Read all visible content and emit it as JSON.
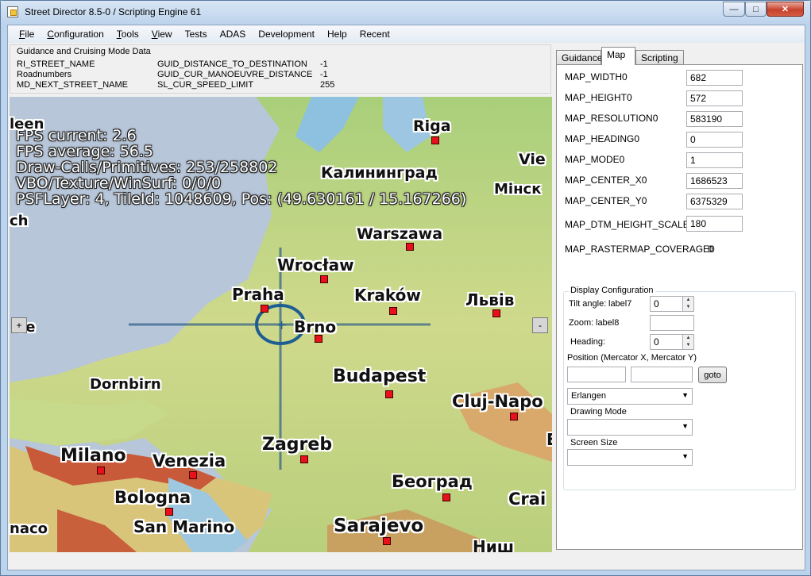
{
  "window": {
    "title": "Street Director 8.5-0 / Scripting Engine 61",
    "min_glyph": "—",
    "max_glyph": "□",
    "close_glyph": "✕"
  },
  "menu": [
    {
      "label": "File",
      "ul": "F",
      "rest": "ile"
    },
    {
      "label": "Configuration",
      "ul": "C",
      "rest": "onfiguration"
    },
    {
      "label": "Tools",
      "ul": "T",
      "rest": "ools"
    },
    {
      "label": "View",
      "ul": "V",
      "rest": "iew"
    },
    {
      "label": "Tests",
      "ul": "",
      "rest": "Tests"
    },
    {
      "label": "ADAS",
      "ul": "",
      "rest": "ADAS"
    },
    {
      "label": "Development",
      "ul": "",
      "rest": "Development"
    },
    {
      "label": "Help",
      "ul": "",
      "rest": "Help"
    },
    {
      "label": "Recent",
      "ul": "",
      "rest": "Recent"
    }
  ],
  "guidance": {
    "legend": "Guidance and Cruising Mode Data",
    "rows": [
      {
        "name": "RI_STREET_NAME",
        "guid": "GUID_DISTANCE_TO_DESTINATION",
        "value": "-1"
      },
      {
        "name": "Roadnumbers",
        "guid": "GUID_CUR_MANOEUVRE_DISTANCE",
        "value": "-1"
      },
      {
        "name": "MD_NEXT_STREET_NAME",
        "guid": "SL_CUR_SPEED_LIMIT",
        "value": "255"
      }
    ]
  },
  "map": {
    "overlay": [
      "FPS current: 2.6",
      "FPS average: 56.5",
      "Draw-Calls/Primitives: 253/258802",
      "VBO/Texture/WinSurf: 0/0/0",
      "PSFLayer: 4, TileId: 1048609, Pos: (49.630161 / 15.167266)"
    ],
    "zoom_in": "+",
    "zoom_out": "-",
    "cities": [
      "leen",
      "Riga",
      "Vie",
      "Калининград",
      "Мінск",
      "ch",
      "Warszawa",
      "Wrocław",
      "Praha",
      "Kraków",
      "Львів",
      "ée",
      "Brno",
      "Dornbirn",
      "Budapest",
      "Cluj-Napo",
      "Zagreb",
      "E",
      "Milano",
      "Venezia",
      "Bologna",
      "Београд",
      "Crai",
      "San Marino",
      "Sarajevo",
      "naco",
      "Ниш"
    ]
  },
  "tabs": {
    "items": [
      "Guidance",
      "Map",
      "Scripting"
    ],
    "active": "Map"
  },
  "map_tab": {
    "fields": [
      {
        "label": "MAP_WIDTH0",
        "value": "682"
      },
      {
        "label": "MAP_HEIGHT0",
        "value": "572"
      },
      {
        "label": "MAP_RESOLUTION0",
        "value": "583190"
      },
      {
        "label": "MAP_HEADING0",
        "value": "0"
      },
      {
        "label": "MAP_MODE0",
        "value": "1"
      },
      {
        "label": "MAP_CENTER_X0",
        "value": "1686523"
      },
      {
        "label": "MAP_CENTER_Y0",
        "value": "6375329"
      },
      {
        "label": "MAP_DTM_HEIGHT_SCALE",
        "value": "180"
      }
    ],
    "raster_label": "MAP_RASTERMAP_COVERAGE0",
    "raster_value": "0",
    "display": {
      "legend": "Display Configuration",
      "tilt_label": "Tilt angle:",
      "tilt_sub": "label7",
      "tilt_value": "0",
      "zoom_label": "Zoom:",
      "zoom_sub": "label8",
      "zoom_value": "",
      "heading_label": "Heading:",
      "heading_value": "0",
      "position_label": "Position (Mercator X, Mercator Y)",
      "pos_x": "",
      "pos_y": "",
      "goto_label": "goto",
      "location_value": "Erlangen",
      "drawing_mode_label": "Drawing Mode",
      "drawing_mode_value": "",
      "screen_size_label": "Screen Size",
      "screen_size_value": ""
    }
  },
  "colors": {
    "sea": "#b7c6d9",
    "land_low": "#8cbf5e",
    "land_mid": "#d9cf84",
    "mountain": "#c85a3a",
    "city_dot": "#e8101a"
  }
}
